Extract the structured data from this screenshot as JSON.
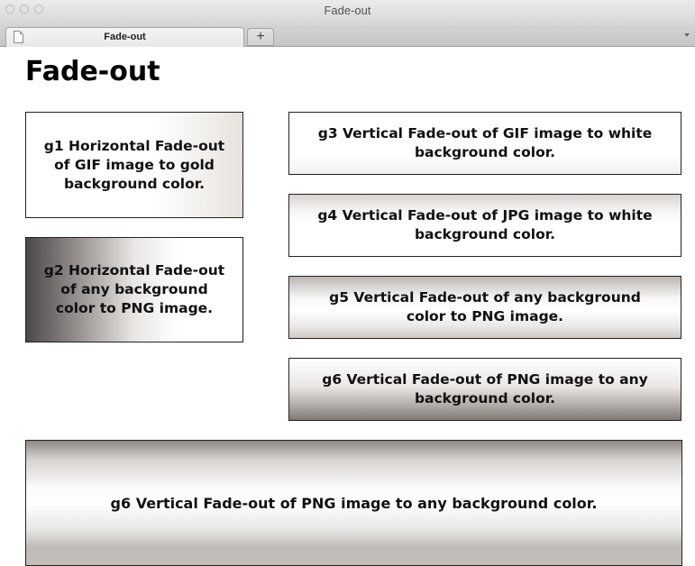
{
  "window": {
    "title": "Fade-out"
  },
  "tabs": [
    {
      "label": "Fade-out"
    }
  ],
  "newtab_symbol": "+",
  "page": {
    "heading": "Fade-out",
    "boxes": [
      {
        "id": "g1",
        "text": "g1 Horizontal Fade-out of GIF image to gold background color."
      },
      {
        "id": "g2",
        "text": "g2 Horizontal Fade-out of any background color to PNG image."
      },
      {
        "id": "g3",
        "text": "g3 Vertical Fade-out of GIF image to white background color."
      },
      {
        "id": "g4",
        "text": "g4 Vertical Fade-out of JPG image to white background color."
      },
      {
        "id": "g5",
        "text": "g5 Vertical Fade-out of any background color to PNG image."
      },
      {
        "id": "g6",
        "text": "g6 Vertical Fade-out of PNG image to any background color."
      },
      {
        "id": "g6-wide",
        "text": "g6 Vertical Fade-out of PNG image to any background color."
      }
    ]
  },
  "icons": {
    "window_controls": [
      "close-icon",
      "minimize-icon",
      "zoom-icon"
    ],
    "tab_icon": "page-icon",
    "tab_overflow": "chevron-down-icon"
  }
}
